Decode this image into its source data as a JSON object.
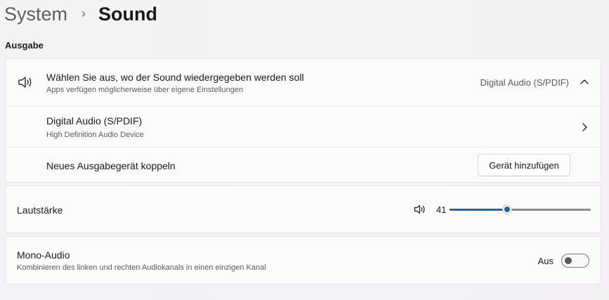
{
  "breadcrumb": {
    "parent": "System",
    "separator": "›",
    "current": "Sound"
  },
  "output": {
    "section_title": "Ausgabe",
    "choose": {
      "title": "Wählen Sie aus, wo der Sound wiedergegeben werden soll",
      "subtitle": "Apps verfügen möglicherweise über eigene Einstellungen",
      "value": "Digital Audio (S/PDIF)",
      "icon": "speaker-icon",
      "expand_icon": "chevron-up-icon"
    },
    "device": {
      "title": "Digital Audio (S/PDIF)",
      "subtitle": "High Definition Audio Device",
      "icon": "chevron-right-icon"
    },
    "pair": {
      "title": "Neues Ausgabegerät koppeln",
      "button_label": "Gerät hinzufügen"
    }
  },
  "volume": {
    "label": "Lautstärke",
    "value": "41",
    "level_percent": 41,
    "icon": "speaker-low-icon"
  },
  "mono": {
    "title": "Mono-Audio",
    "subtitle": "Kombinieren des linken und rechten Audiokanals in einen einzigen Kanal",
    "state_label": "Aus",
    "checked": false
  },
  "colors": {
    "accent": "#1b64b4",
    "track": "#8a8a8a"
  }
}
